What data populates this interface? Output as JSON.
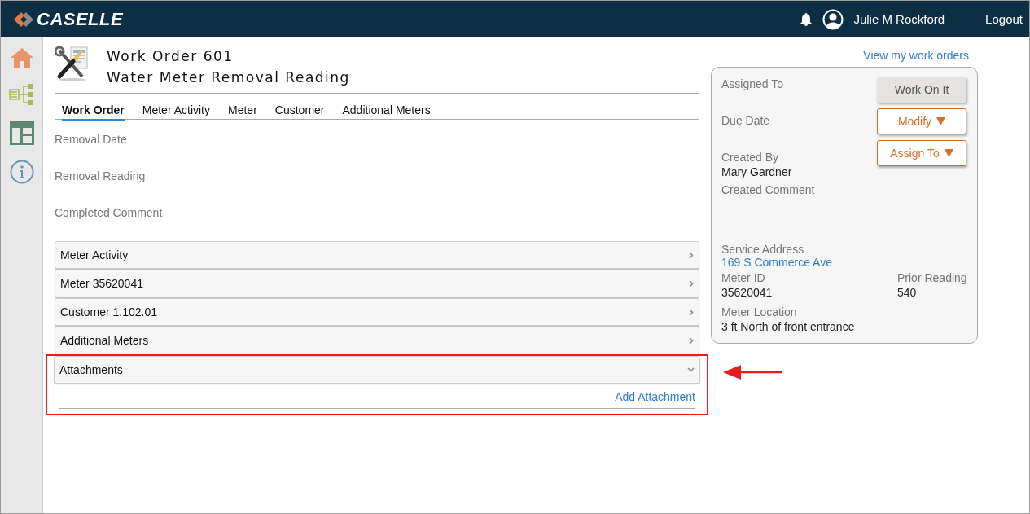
{
  "header": {
    "logo": "CASELLE",
    "user": "Julie M Rockford",
    "logout": "Logout"
  },
  "work_order": {
    "title": "Work Order 601",
    "subtitle": "Water Meter Removal Reading"
  },
  "tabs": [
    {
      "label": "Work Order",
      "selected": true
    },
    {
      "label": "Meter Activity",
      "selected": false
    },
    {
      "label": "Meter",
      "selected": false
    },
    {
      "label": "Customer",
      "selected": false
    },
    {
      "label": "Additional Meters",
      "selected": false
    }
  ],
  "fields": [
    "Removal Date",
    "Removal Reading",
    "Completed Comment"
  ],
  "sections": [
    {
      "label": "Meter Activity",
      "expanded": false,
      "highlighted": false
    },
    {
      "label": "Meter 35620041",
      "expanded": false,
      "highlighted": false
    },
    {
      "label": "Customer 1.102.01",
      "expanded": false,
      "highlighted": false
    },
    {
      "label": "Additional Meters",
      "expanded": false,
      "highlighted": false
    },
    {
      "label": "Attachments",
      "expanded": true,
      "highlighted": true,
      "action": "Add Attachment"
    }
  ],
  "view_link": "View my work orders",
  "panel": {
    "assigned_to_label": "Assigned To",
    "due_date_label": "Due Date",
    "created_by_label": "Created By",
    "created_by": "Mary Gardner",
    "created_comment_label": "Created Comment",
    "buttons": [
      {
        "label": "Work On It",
        "kind": "plain"
      },
      {
        "label": "Modify",
        "kind": "dropdown"
      },
      {
        "label": "Assign To",
        "kind": "dropdown"
      }
    ],
    "service_address_label": "Service Address",
    "service_address": "169 S Commerce Ave",
    "meter_id_label": "Meter ID",
    "meter_id": "35620041",
    "prior_reading_label": "Prior Reading",
    "prior_reading": "540",
    "meter_location_label": "Meter Location",
    "meter_location": "3 ft North of front entrance"
  }
}
